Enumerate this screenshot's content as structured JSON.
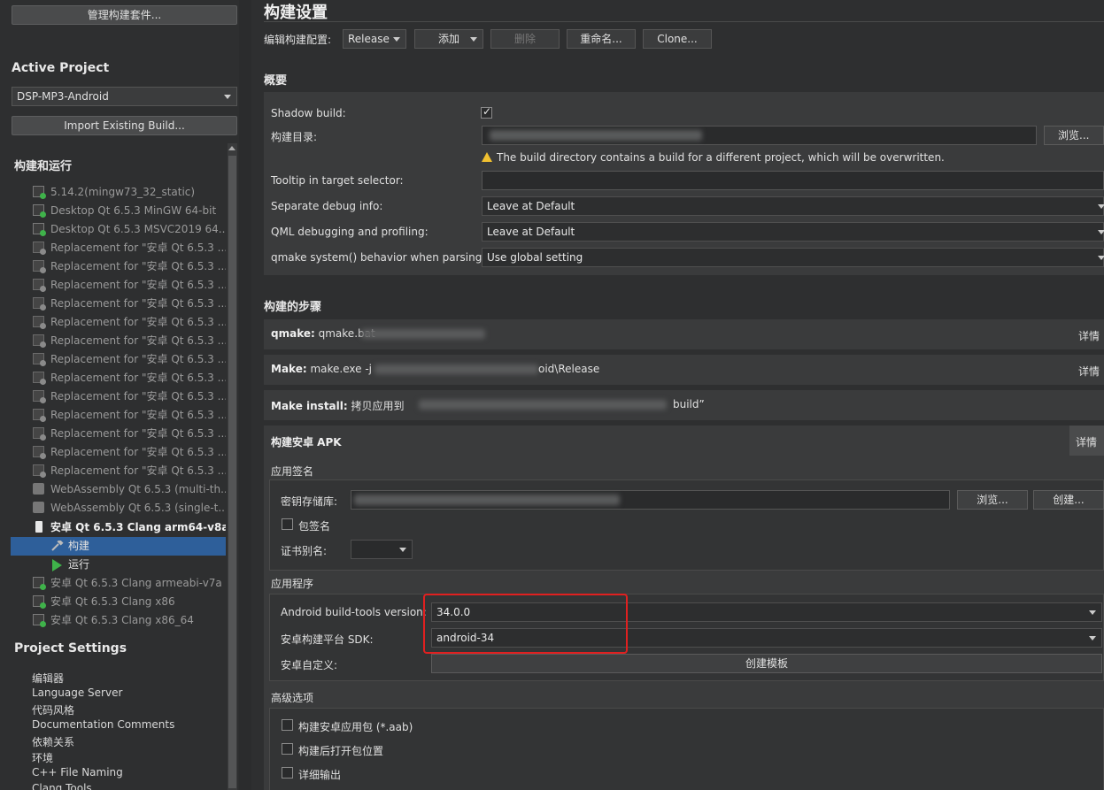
{
  "left": {
    "manage_kits_label": "管理构建套件...",
    "active_project_title": "Active Project",
    "project_selected": "DSP-MP3-Android",
    "import_label": "Import Existing Build...",
    "build_run_title": "构建和运行",
    "kits": [
      {
        "label": "5.14.2(mingw73_32_static)",
        "icon": "kit-ok-icon"
      },
      {
        "label": "Desktop Qt 6.5.3 MinGW 64-bit",
        "icon": "kit-ok-icon"
      },
      {
        "label": "Desktop Qt 6.5.3 MSVC2019 64...",
        "icon": "kit-ok-icon"
      },
      {
        "label": "Replacement for \"安卓 Qt 6.5.3 ...",
        "icon": "kit-disabled-icon"
      },
      {
        "label": "Replacement for \"安卓 Qt 6.5.3 ...",
        "icon": "kit-disabled-icon"
      },
      {
        "label": "Replacement for \"安卓 Qt 6.5.3 ...",
        "icon": "kit-disabled-icon"
      },
      {
        "label": "Replacement for \"安卓 Qt 6.5.3 ...",
        "icon": "kit-disabled-icon"
      },
      {
        "label": "Replacement for \"安卓 Qt 6.5.3 ...",
        "icon": "kit-disabled-icon"
      },
      {
        "label": "Replacement for \"安卓 Qt 6.5.3 ...",
        "icon": "kit-disabled-icon"
      },
      {
        "label": "Replacement for \"安卓 Qt 6.5.3 ...",
        "icon": "kit-disabled-icon"
      },
      {
        "label": "Replacement for \"安卓 Qt 6.5.3 ...",
        "icon": "kit-disabled-icon"
      },
      {
        "label": "Replacement for \"安卓 Qt 6.5.3 ...",
        "icon": "kit-disabled-icon"
      },
      {
        "label": "Replacement for \"安卓 Qt 6.5.3 ...",
        "icon": "kit-disabled-icon"
      },
      {
        "label": "Replacement for \"安卓 Qt 6.5.3 ...",
        "icon": "kit-disabled-icon"
      },
      {
        "label": "Replacement for \"安卓 Qt 6.5.3 ...",
        "icon": "kit-disabled-icon"
      },
      {
        "label": "Replacement for \"安卓 Qt 6.5.3 ...",
        "icon": "kit-disabled-icon"
      },
      {
        "label": "WebAssembly Qt 6.5.3 (multi-th...",
        "icon": "webassembly-icon"
      },
      {
        "label": "WebAssembly Qt 6.5.3 (single-t...",
        "icon": "webassembly-icon"
      }
    ],
    "active_kit": "安卓 Qt 6.5.3 Clang arm64-v8a",
    "sub_build": "构建",
    "sub_run": "运行",
    "kits_after": [
      "安卓 Qt 6.5.3 Clang armeabi-v7a",
      "安卓 Qt 6.5.3 Clang x86",
      "安卓 Qt 6.5.3 Clang x86_64"
    ],
    "project_settings_title": "Project Settings",
    "project_settings": [
      "编辑器",
      "Language Server",
      "代码风格",
      "Documentation Comments",
      "依赖关系",
      "环境",
      "C++ File Naming",
      "Clang Tools"
    ]
  },
  "main": {
    "title": "构建设置",
    "edit_config_label": "编辑构建配置:",
    "config_selected": "Release",
    "add_label": "添加",
    "delete_label": "删除",
    "rename_label": "重命名...",
    "clone_label": "Clone...",
    "overview_title": "概要",
    "shadow_build_label": "Shadow build:",
    "build_dir_label": "构建目录:",
    "browse_label": "浏览...",
    "warning_text": "The build directory contains a build for a different project, which will be overwritten.",
    "tooltip_label": "Tooltip in target selector:",
    "sep_debug_label": "Separate debug info:",
    "sep_debug_value": "Leave at Default",
    "qml_debug_label": "QML debugging and profiling:",
    "qml_debug_value": "Leave at Default",
    "qmake_behavior_label": "qmake system() behavior when parsing:",
    "qmake_behavior_value": "Use global setting",
    "steps_title": "构建的步骤",
    "step_qmake_name": "qmake:",
    "step_qmake_text": "qmake.bat",
    "step_make_name": "Make:",
    "step_make_text": "make.exe -j",
    "step_make_suffix": "oid\\Release",
    "step_install_name": "Make install:",
    "step_install_text": "拷贝应用到",
    "step_install_suffix": "build”",
    "details_label": "详情",
    "apk_title": "构建安卓 APK",
    "signing_title": "应用签名",
    "keystore_label": "密钥存储库:",
    "browse2_label": "浏览...",
    "create_label": "创建...",
    "sign_package_label": "包签名",
    "cert_alias_label": "证书别名:",
    "application_title": "应用程序",
    "build_tools_label": "Android build-tools version:",
    "build_tools_value": "34.0.0",
    "platform_sdk_label": "安卓构建平台 SDK:",
    "platform_sdk_value": "android-34",
    "customize_label": "安卓自定义:",
    "create_template_label": "创建模板",
    "advanced_title": "高级选项",
    "aab_label": "构建安卓应用包 (*.aab)",
    "open_location_label": "构建后打开包位置",
    "verbose_label": "详细输出"
  }
}
